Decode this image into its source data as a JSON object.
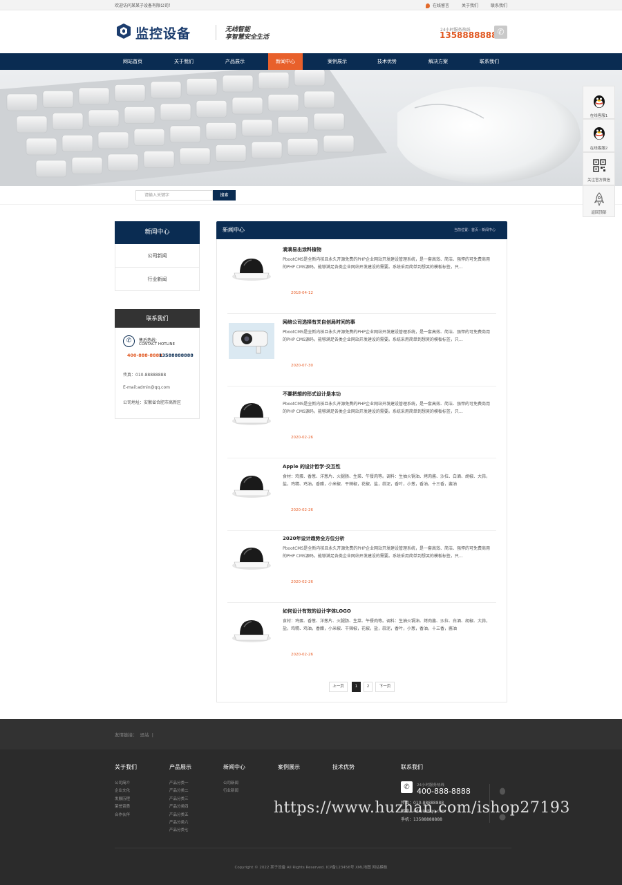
{
  "topbar": {
    "welcome": "欢迎访问某某子设备有限公司！",
    "links": [
      "在线留言",
      "关于我们",
      "联系我们"
    ]
  },
  "header": {
    "logo_text": "监控设备",
    "slogan_line1": "无线智能",
    "slogan_line2": "享智慧安全生活",
    "hotline_label": "24小时服务热线",
    "hotline_number": "13588888888"
  },
  "nav": {
    "items": [
      {
        "label": "网站首页"
      },
      {
        "label": "关于我们"
      },
      {
        "label": "产品展示"
      },
      {
        "label": "新闻中心"
      },
      {
        "label": "案例展示"
      },
      {
        "label": "技术优势"
      },
      {
        "label": "解决方案"
      },
      {
        "label": "联系我们"
      }
    ],
    "active_index": 3
  },
  "search": {
    "placeholder": "请输入关键字",
    "button_label": "搜索"
  },
  "sidebar": {
    "title": "新闻中心",
    "items": [
      "公司新闻",
      "行业新闻"
    ],
    "contact_title": "联系我们",
    "contact_hotline_cn": "售后热线:",
    "contact_hotline_en": "CONTACT HOTLINE",
    "contact_numbers": "400-888-8888",
    "contact_mobile": "13588888888",
    "fax": "传真：010-88888888",
    "email": "E-mail:admin@qq.com",
    "address": "公司地址：安徽省合肥市高新区"
  },
  "main": {
    "title": "新闻中心",
    "breadcrumb": "当前位置：首页 › 新闻中心",
    "news": [
      {
        "title": "滴滴易出涂料植物",
        "desc": "PbootCMS是全新内核且永久开源免费的PHP企业网站开发建设管理系统，是一套高效、简洁、强悍的可免费商用的PHP CMS源码，能够满足各类企业网站开发建设的需要。系统采用简单到想哭的模板标签，只…",
        "date": "2018-04-12",
        "thumb": "dome"
      },
      {
        "title": "网络公司选择有关自创局时间的事",
        "desc": "PbootCMS是全新内核且永久开源免费的PHP企业网站开发建设管理系统，是一套高效、简洁、强悍的可免费商用的PHP CMS源码，能够满足各类企业网站开发建设的需要。系统采用简单到想哭的模板标签，只…",
        "date": "2020-07-30",
        "thumb": "bullet"
      },
      {
        "title": "不要把想的形式设计是本功",
        "desc": "PbootCMS是全新内核且永久开源免费的PHP企业网站开发建设管理系统，是一套高效、简洁、强悍的可免费商用的PHP CMS源码，能够满足各类企业网站开发建设的需要。系统采用简单到想哭的模板标签，只…",
        "date": "2020-02-26",
        "thumb": "dome"
      },
      {
        "title": "Apple 的设计哲学·交互性",
        "desc": "食材：鸡蛋、香葱、洋葱片、火腿肠、生菜、午餐肉等。调料：生抽火锅油、烤肉酱、沙拉、白酒、胡椒、大蒜，盐，鸡精、鸡油，香醋，小米椒、干辣椒，花椒，盐，蒜泥，香叶，小葱，香油，十三香，酱油",
        "date": "2020-02-26",
        "thumb": "dome"
      },
      {
        "title": "2020年设计趋势全方位分析",
        "desc": "PbootCMS是全新内核且永久开源免费的PHP企业网站开发建设管理系统，是一套高效、简洁、强悍的可免费商用的PHP CMS源码，能够满足各类企业网站开发建设的需要。系统采用简单到想哭的模板标签，只…",
        "date": "2020-02-26",
        "thumb": "dome"
      },
      {
        "title": "如何设计有效的设计字体LOGO",
        "desc": "食材：鸡蛋、香葱、洋葱片、火腿肠、生菜、午餐肉等。调料：生抽火锅油、烤肉酱、沙拉、白酒、胡椒、大蒜，盐，鸡精、鸡油，香醋，小米椒、干辣椒，花椒，盐，蒜泥，香叶，小葱，香油，十三香，酱油",
        "date": "2020-02-26",
        "thumb": "dome"
      }
    ],
    "pager": {
      "prev": "上一页",
      "pages": [
        "1",
        "2"
      ],
      "current": "1",
      "next": "下一页"
    }
  },
  "float_panel": {
    "items": [
      {
        "label": "在线客服1",
        "icon": "qq-penguin-icon"
      },
      {
        "label": "在线客服2",
        "icon": "qq-penguin-icon"
      },
      {
        "label": "关注官方微信",
        "icon": "qr-code-icon"
      },
      {
        "label": "返回顶部",
        "icon": "rocket-icon"
      }
    ]
  },
  "footer": {
    "friend_links_label": "友情链接：",
    "friend_links": [
      "迅站"
    ],
    "columns": [
      {
        "title": "关于我们",
        "items": [
          "公司简介",
          "企业文化",
          "发展历程",
          "荣誉资质",
          "合作伙伴"
        ]
      },
      {
        "title": "产品展示",
        "items": [
          "产品分类一",
          "产品分类二",
          "产品分类三",
          "产品分类四",
          "产品分类五",
          "产品分类六",
          "产品分类七"
        ]
      },
      {
        "title": "新闻中心",
        "items": [
          "公司新闻",
          "行业新闻"
        ]
      },
      {
        "title": "案例展示",
        "items": []
      },
      {
        "title": "技术优势",
        "items": []
      },
      {
        "title": "联系我们",
        "items": []
      }
    ],
    "hotline_label": "24小时服务热线",
    "hotline_number": "400-888-8888",
    "fax": "传真：010-88888888",
    "email": "邮箱：admin@qq.com",
    "mobile": "手机：13588888888",
    "copyright": "Copyright © 2022 某子设备 All Rights Reserved.    ICP备123456号 XML地图 网站模板",
    "watermark": "https://www.huzhan.com/ishop27193"
  },
  "colors": {
    "navy": "#0a2c52",
    "accent": "#e8602b",
    "footer_bg": "#2b2b2b"
  }
}
